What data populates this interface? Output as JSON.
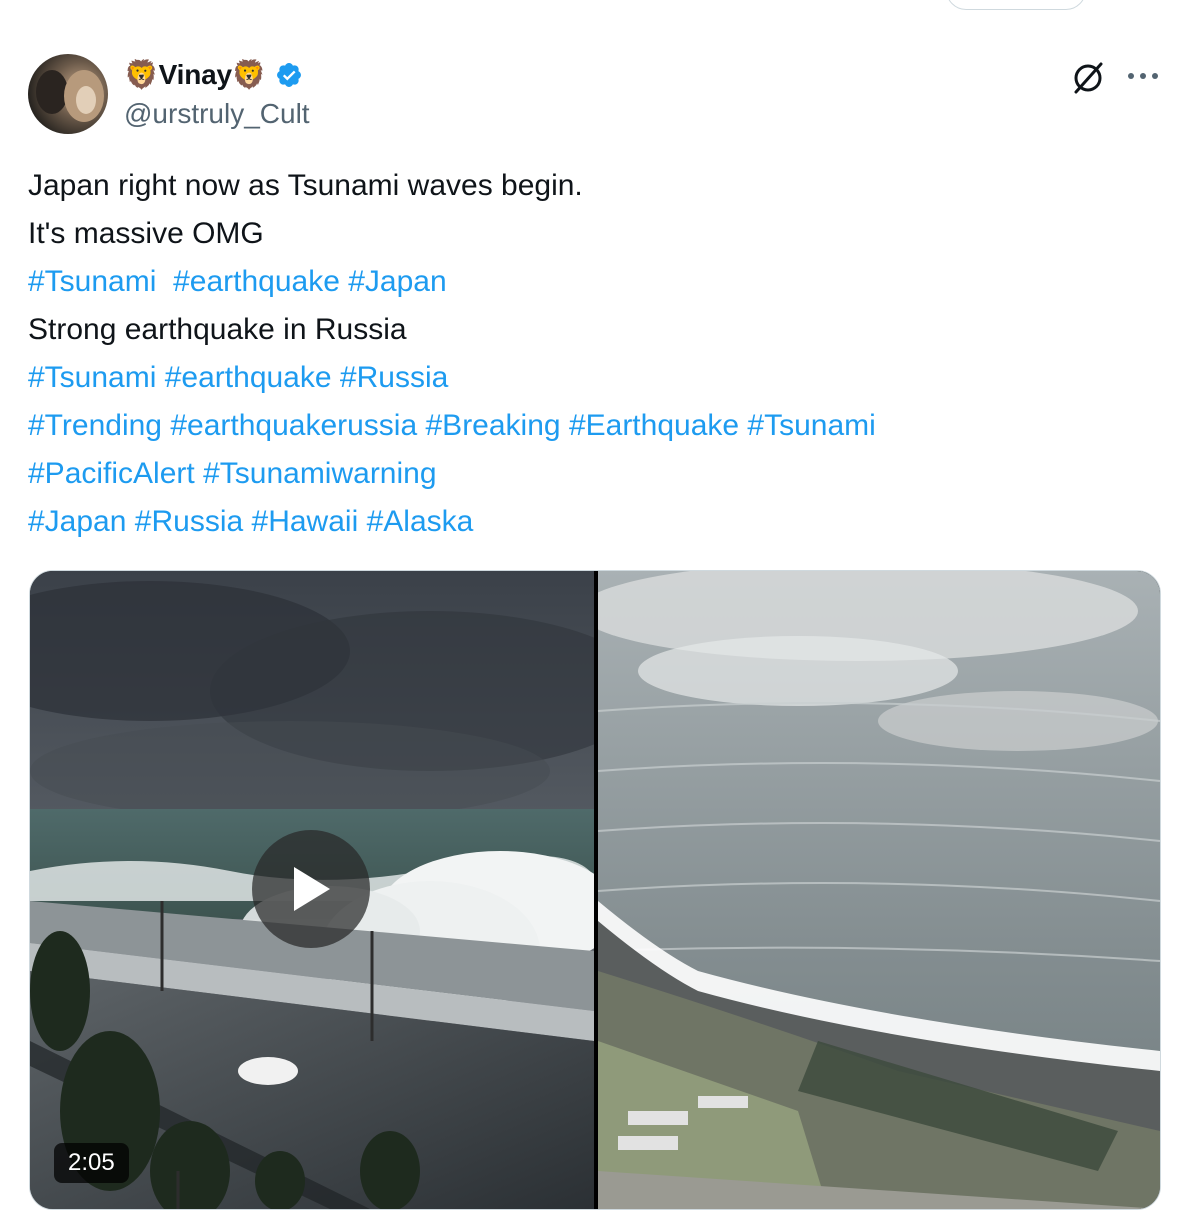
{
  "author": {
    "display_name": "🦁Vinay🦁",
    "handle": "@urstruly_Cult",
    "verified": true,
    "verified_color": "#1d9bf0"
  },
  "actions": {
    "grok_icon": "grok-icon",
    "more_icon": "more-icon"
  },
  "tweet": {
    "lines": [
      "Japan right now as Tsunami waves begin.",
      "It's massive OMG",
      "Strong earthquake in Russia"
    ],
    "hashtag_lines": [
      [
        "#Tsunami",
        "#earthquake",
        "#Japan"
      ],
      [
        "#Tsunami",
        "#earthquake",
        "#Russia"
      ],
      [
        "#Trending",
        "#earthquakerussia",
        "#Breaking",
        "#Earthquake",
        "#Tsunami"
      ],
      [
        "#PacificAlert",
        "#Tsunamiwarning"
      ],
      [
        "#Japan",
        "#Russia",
        "#Hawaii",
        "#Alaska"
      ]
    ],
    "hashtag_color": "#1d9bf0"
  },
  "media": {
    "video_duration": "2:05",
    "play_icon": "play-icon"
  }
}
